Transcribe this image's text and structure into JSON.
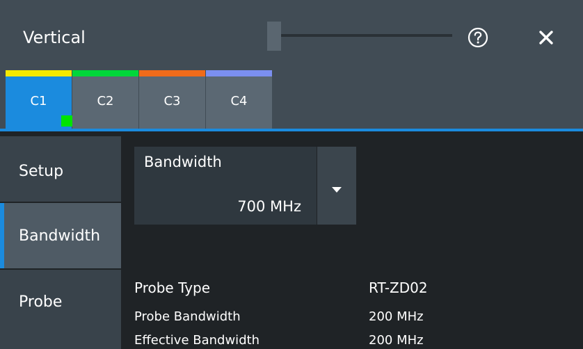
{
  "header": {
    "title": "Vertical",
    "help_icon": "help-circle-icon",
    "close_icon": "close-icon"
  },
  "tabs": [
    {
      "label": "C1",
      "color": "#f5e900",
      "active": true
    },
    {
      "label": "C2",
      "color": "#00d63a",
      "active": false
    },
    {
      "label": "C3",
      "color": "#f06b1a",
      "active": false
    },
    {
      "label": "C4",
      "color": "#7b8ff0",
      "active": false
    }
  ],
  "side_nav": {
    "items": [
      {
        "label": "Setup",
        "active": false
      },
      {
        "label": "Bandwidth",
        "active": true
      },
      {
        "label": "Probe",
        "active": false
      }
    ]
  },
  "bandwidth_select": {
    "label": "Bandwidth",
    "value": "700 MHz",
    "icon": "chevron-down-icon"
  },
  "probe_info": {
    "probe_type_label": "Probe Type",
    "probe_type_value": "RT-ZD02",
    "probe_bandwidth_label": "Probe Bandwidth",
    "probe_bandwidth_value": "200 MHz",
    "effective_bandwidth_label": "Effective Bandwidth",
    "effective_bandwidth_value": "200 MHz"
  },
  "colors": {
    "accent": "#1b8bde",
    "active_indicator": "#00e400"
  }
}
